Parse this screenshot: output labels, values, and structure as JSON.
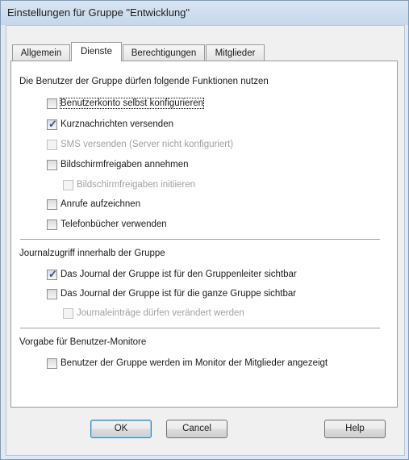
{
  "window": {
    "title": "Einstellungen für Gruppe \"Entwicklung\""
  },
  "tabs": [
    {
      "label": "Allgemein",
      "active": false
    },
    {
      "label": "Dienste",
      "active": true
    },
    {
      "label": "Berechtigungen",
      "active": false
    },
    {
      "label": "Mitglieder",
      "active": false
    }
  ],
  "sections": {
    "functions": {
      "heading": "Die Benutzer der Gruppe dürfen folgende Funktionen nutzen",
      "options": [
        {
          "label": "Benutzerkonto selbst konfigurieren",
          "checked": false,
          "enabled": true,
          "focused": true
        },
        {
          "label": "Kurznachrichten versenden",
          "checked": true,
          "enabled": true
        },
        {
          "label": "SMS versenden (Server nicht konfiguriert)",
          "checked": false,
          "enabled": false
        },
        {
          "label": "Bildschirmfreigaben annehmen",
          "checked": false,
          "enabled": true
        },
        {
          "label": "Bildschirmfreigaben initiieren",
          "checked": false,
          "enabled": false
        },
        {
          "label": "Anrufe aufzeichnen",
          "checked": false,
          "enabled": true
        },
        {
          "label": "Telefonbücher verwenden",
          "checked": false,
          "enabled": true
        }
      ]
    },
    "journal": {
      "heading": "Journalzugriff innerhalb der Gruppe",
      "options": [
        {
          "label": "Das Journal der Gruppe ist für den Gruppenleiter sichtbar",
          "checked": true,
          "enabled": true
        },
        {
          "label": "Das Journal der Gruppe ist für die ganze Gruppe sichtbar",
          "checked": false,
          "enabled": true
        },
        {
          "label": "Journaleinträge dürfen verändert werden",
          "checked": false,
          "enabled": false
        }
      ]
    },
    "monitor": {
      "heading": "Vorgabe für Benutzer-Monitore",
      "options": [
        {
          "label": "Benutzer der Gruppe werden im Monitor der Mitglieder angezeigt",
          "checked": false,
          "enabled": true
        }
      ]
    }
  },
  "buttons": {
    "ok": "OK",
    "cancel": "Cancel",
    "help": "Help"
  },
  "colors": {
    "checkmark": "#2a4fa0",
    "disabled_text": "#a0a0a0",
    "title_bar": "#c6d7ec"
  }
}
